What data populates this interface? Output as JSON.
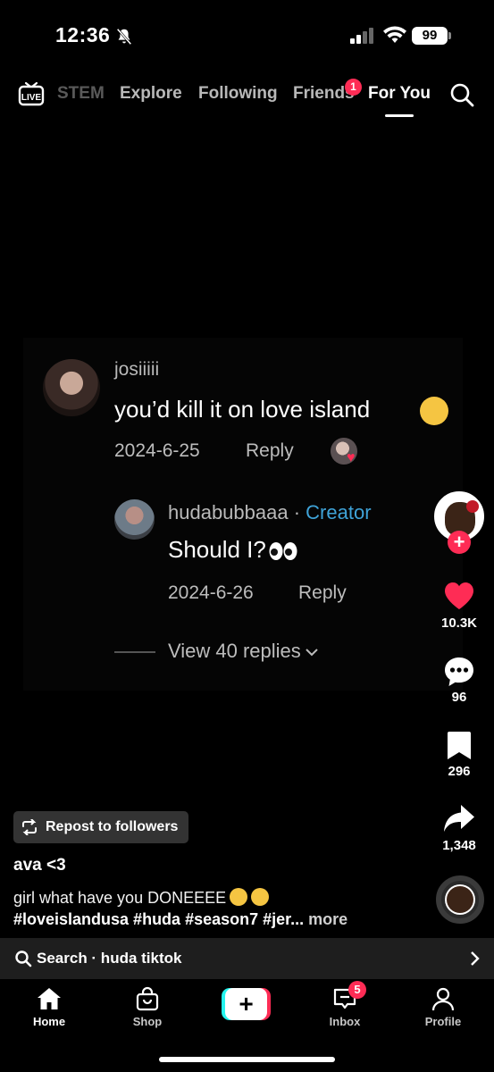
{
  "status_bar": {
    "time": "12:36",
    "battery": "99"
  },
  "top_nav": {
    "live_label": "LIVE",
    "tabs": [
      {
        "label": "STEM"
      },
      {
        "label": "Explore"
      },
      {
        "label": "Following"
      },
      {
        "label": "Friends",
        "badge": "1"
      },
      {
        "label": "For You",
        "active": true
      }
    ]
  },
  "comment": {
    "username": "josiiiii",
    "text": "you’d kill it on love island",
    "date": "2024-6-25",
    "reply_label": "Reply",
    "reply": {
      "username": "hudabubbaaa",
      "separator": " · ",
      "creator_tag": "Creator",
      "text": "Should I?",
      "date": "2024-6-26",
      "reply_label": "Reply"
    },
    "view_replies": "View 40 replies"
  },
  "actions": {
    "likes": "10.3K",
    "comments": "96",
    "saves": "296",
    "shares": "1,348"
  },
  "post": {
    "repost_label": "Repost to followers",
    "author": "ava <3",
    "caption_line1": "girl what have you DONEEEE",
    "caption_line2": "#loveislandusa #huda #season7 #jer...",
    "more_label": " more"
  },
  "search_bar": {
    "text": "Search · huda tiktok"
  },
  "bottom_nav": {
    "home": "Home",
    "shop": "Shop",
    "inbox": "Inbox",
    "inbox_badge": "5",
    "profile": "Profile",
    "create": "+"
  },
  "colors": {
    "accent": "#fe2c55",
    "creator": "#3fa3d8",
    "cyan": "#25f4ee"
  }
}
